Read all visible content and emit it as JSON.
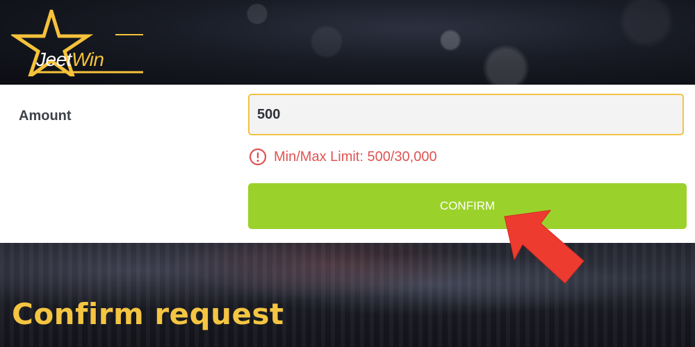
{
  "brand": {
    "name_part1": "Jeet",
    "name_part2": "Win",
    "accent_color": "#f5c23a"
  },
  "form": {
    "amount_label": "Amount",
    "amount_value": "500",
    "limit_icon": "alert-circle-icon",
    "limit_text": "Min/Max Limit: 500/30,000",
    "confirm_label": "CONFIRM"
  },
  "caption": "Confirm request",
  "colors": {
    "input_border": "#f2c244",
    "button_bg": "#9bd12b",
    "error_text": "#e05352",
    "arrow": "#ee3b30",
    "caption_text": "#f5c542"
  },
  "annotation_icon": "red-arrow-icon"
}
